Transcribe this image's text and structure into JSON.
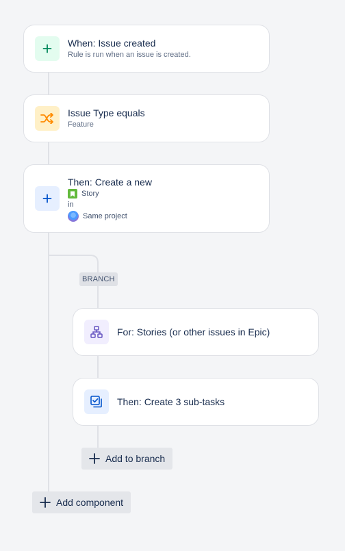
{
  "trigger": {
    "title": "When: Issue created",
    "subtitle": "Rule is run when an issue is created.",
    "icon": "plus-icon",
    "icon_bg": "#e3fcef",
    "icon_color": "#00875a"
  },
  "condition": {
    "title": "Issue Type equals",
    "subtitle": "Feature",
    "icon": "shuffle-icon",
    "icon_bg": "#fff0c7",
    "icon_color": "#ff8b00"
  },
  "action": {
    "title": "Then: Create a new",
    "issue_type": "Story",
    "connector_word": "in",
    "project": "Same project",
    "icon": "plus-icon",
    "icon_bg": "#e6efff",
    "icon_color": "#0052cc"
  },
  "branch": {
    "label": "BRANCH",
    "for_title": "For: Stories (or other issues in Epic)",
    "for_icon": "hierarchy-icon",
    "for_icon_bg": "#f1eefe",
    "for_icon_color": "#6554c0",
    "subtasks_title": "Then: Create 3 sub-tasks",
    "subtasks_icon": "subtask-icon",
    "subtasks_icon_bg": "#e6efff",
    "subtasks_icon_color": "#0052cc",
    "add_label": "Add to branch"
  },
  "add_component_label": "Add component",
  "colors": {
    "background": "#f4f5f7",
    "connector": "#dfe1e6",
    "story_green": "#63ba3c"
  }
}
